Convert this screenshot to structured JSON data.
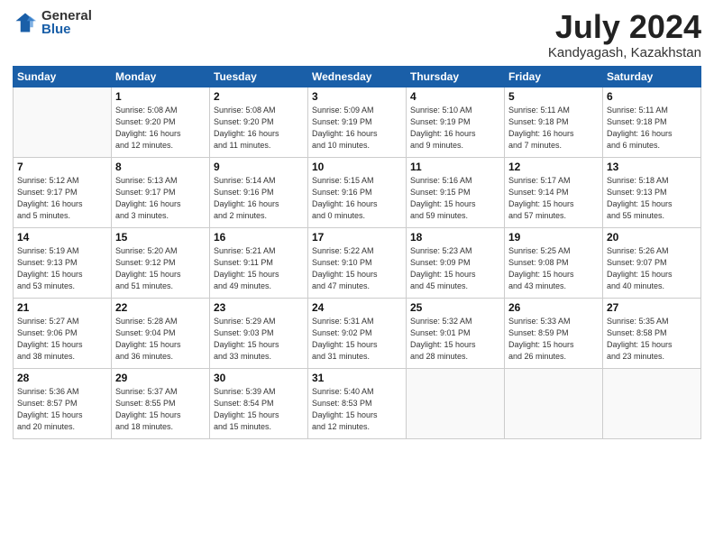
{
  "header": {
    "logo_general": "General",
    "logo_blue": "Blue",
    "month_title": "July 2024",
    "subtitle": "Kandyagash, Kazakhstan"
  },
  "weekdays": [
    "Sunday",
    "Monday",
    "Tuesday",
    "Wednesday",
    "Thursday",
    "Friday",
    "Saturday"
  ],
  "weeks": [
    [
      {
        "day": "",
        "info": ""
      },
      {
        "day": "1",
        "info": "Sunrise: 5:08 AM\nSunset: 9:20 PM\nDaylight: 16 hours\nand 12 minutes."
      },
      {
        "day": "2",
        "info": "Sunrise: 5:08 AM\nSunset: 9:20 PM\nDaylight: 16 hours\nand 11 minutes."
      },
      {
        "day": "3",
        "info": "Sunrise: 5:09 AM\nSunset: 9:19 PM\nDaylight: 16 hours\nand 10 minutes."
      },
      {
        "day": "4",
        "info": "Sunrise: 5:10 AM\nSunset: 9:19 PM\nDaylight: 16 hours\nand 9 minutes."
      },
      {
        "day": "5",
        "info": "Sunrise: 5:11 AM\nSunset: 9:18 PM\nDaylight: 16 hours\nand 7 minutes."
      },
      {
        "day": "6",
        "info": "Sunrise: 5:11 AM\nSunset: 9:18 PM\nDaylight: 16 hours\nand 6 minutes."
      }
    ],
    [
      {
        "day": "7",
        "info": "Sunrise: 5:12 AM\nSunset: 9:17 PM\nDaylight: 16 hours\nand 5 minutes."
      },
      {
        "day": "8",
        "info": "Sunrise: 5:13 AM\nSunset: 9:17 PM\nDaylight: 16 hours\nand 3 minutes."
      },
      {
        "day": "9",
        "info": "Sunrise: 5:14 AM\nSunset: 9:16 PM\nDaylight: 16 hours\nand 2 minutes."
      },
      {
        "day": "10",
        "info": "Sunrise: 5:15 AM\nSunset: 9:16 PM\nDaylight: 16 hours\nand 0 minutes."
      },
      {
        "day": "11",
        "info": "Sunrise: 5:16 AM\nSunset: 9:15 PM\nDaylight: 15 hours\nand 59 minutes."
      },
      {
        "day": "12",
        "info": "Sunrise: 5:17 AM\nSunset: 9:14 PM\nDaylight: 15 hours\nand 57 minutes."
      },
      {
        "day": "13",
        "info": "Sunrise: 5:18 AM\nSunset: 9:13 PM\nDaylight: 15 hours\nand 55 minutes."
      }
    ],
    [
      {
        "day": "14",
        "info": "Sunrise: 5:19 AM\nSunset: 9:13 PM\nDaylight: 15 hours\nand 53 minutes."
      },
      {
        "day": "15",
        "info": "Sunrise: 5:20 AM\nSunset: 9:12 PM\nDaylight: 15 hours\nand 51 minutes."
      },
      {
        "day": "16",
        "info": "Sunrise: 5:21 AM\nSunset: 9:11 PM\nDaylight: 15 hours\nand 49 minutes."
      },
      {
        "day": "17",
        "info": "Sunrise: 5:22 AM\nSunset: 9:10 PM\nDaylight: 15 hours\nand 47 minutes."
      },
      {
        "day": "18",
        "info": "Sunrise: 5:23 AM\nSunset: 9:09 PM\nDaylight: 15 hours\nand 45 minutes."
      },
      {
        "day": "19",
        "info": "Sunrise: 5:25 AM\nSunset: 9:08 PM\nDaylight: 15 hours\nand 43 minutes."
      },
      {
        "day": "20",
        "info": "Sunrise: 5:26 AM\nSunset: 9:07 PM\nDaylight: 15 hours\nand 40 minutes."
      }
    ],
    [
      {
        "day": "21",
        "info": "Sunrise: 5:27 AM\nSunset: 9:06 PM\nDaylight: 15 hours\nand 38 minutes."
      },
      {
        "day": "22",
        "info": "Sunrise: 5:28 AM\nSunset: 9:04 PM\nDaylight: 15 hours\nand 36 minutes."
      },
      {
        "day": "23",
        "info": "Sunrise: 5:29 AM\nSunset: 9:03 PM\nDaylight: 15 hours\nand 33 minutes."
      },
      {
        "day": "24",
        "info": "Sunrise: 5:31 AM\nSunset: 9:02 PM\nDaylight: 15 hours\nand 31 minutes."
      },
      {
        "day": "25",
        "info": "Sunrise: 5:32 AM\nSunset: 9:01 PM\nDaylight: 15 hours\nand 28 minutes."
      },
      {
        "day": "26",
        "info": "Sunrise: 5:33 AM\nSunset: 8:59 PM\nDaylight: 15 hours\nand 26 minutes."
      },
      {
        "day": "27",
        "info": "Sunrise: 5:35 AM\nSunset: 8:58 PM\nDaylight: 15 hours\nand 23 minutes."
      }
    ],
    [
      {
        "day": "28",
        "info": "Sunrise: 5:36 AM\nSunset: 8:57 PM\nDaylight: 15 hours\nand 20 minutes."
      },
      {
        "day": "29",
        "info": "Sunrise: 5:37 AM\nSunset: 8:55 PM\nDaylight: 15 hours\nand 18 minutes."
      },
      {
        "day": "30",
        "info": "Sunrise: 5:39 AM\nSunset: 8:54 PM\nDaylight: 15 hours\nand 15 minutes."
      },
      {
        "day": "31",
        "info": "Sunrise: 5:40 AM\nSunset: 8:53 PM\nDaylight: 15 hours\nand 12 minutes."
      },
      {
        "day": "",
        "info": ""
      },
      {
        "day": "",
        "info": ""
      },
      {
        "day": "",
        "info": ""
      }
    ]
  ]
}
